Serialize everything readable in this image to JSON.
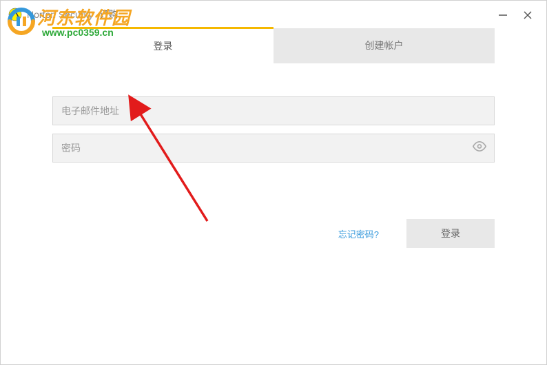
{
  "window": {
    "title": "Norton Security",
    "subtitle": "订购"
  },
  "watermark": {
    "text": "河东软件园",
    "url": "www.pc0359.cn"
  },
  "tabs": {
    "login": "登录",
    "create": "创建帐户"
  },
  "form": {
    "email_placeholder": "电子邮件地址",
    "password_placeholder": "密码"
  },
  "actions": {
    "forgot": "忘记密码?",
    "login": "登录"
  }
}
